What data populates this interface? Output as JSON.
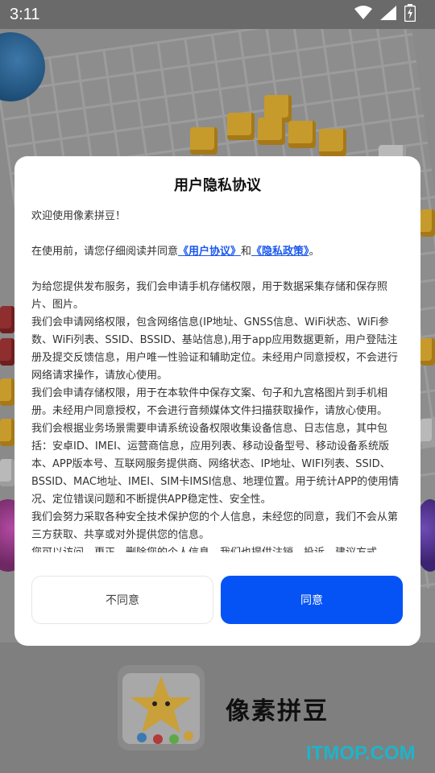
{
  "status_bar": {
    "time": "3:11",
    "icons": [
      "wifi-icon",
      "signal-icon",
      "battery-icon"
    ]
  },
  "dialog": {
    "title": "用户隐私协议",
    "welcome": "欢迎使用像素拼豆！",
    "intro_prefix": "在使用前，请您仔细阅读并同意",
    "user_agreement_link": "《用户协议》",
    "intro_and": "和",
    "privacy_policy_link": "《隐私政策》",
    "intro_suffix": "。",
    "paragraphs": [
      "为给您提供发布服务，我们会申请手机存储权限，用于数据采集存储和保存照片、图片。",
      "我们会申请网络权限，包含网络信息(IP地址、GNSS信息、WiFi状态、WiFi参数、WiFi列表、SSID、BSSID、基站信息),用于app应用数据更新，用户登陆注册及提交反馈信息，用户唯一性验证和辅助定位。未经用户同意授权，不会进行网络请求操作，请放心使用。",
      "我们会申请存储权限，用于在本软件中保存文案、句子和九宫格图片到手机相册。未经用户同意授权，不会进行音频媒体文件扫描获取操作，请放心使用。",
      "我们会根据业务场景需要申请系统设备权限收集设备信息、日志信息，其中包括：安卓ID、IMEI、运营商信息，应用列表、移动设备型号、移动设备系统版本、APP版本号、互联网服务提供商、网络状态、IP地址、WIFI列表、SSID、BSSID、MAC地址、IMEI、SIM卡IMSI信息、地理位置。用于统计APP的使用情况、定位错误问题和不断提供APP稳定性、安全性。",
      "我们会努力采取各种安全技术保护您的个人信息，未经您的同意，我们不会从第三方获取、共享或对外提供您的信息。",
      "您可以访问、更正、删除您的个人信息，我们也提供注销、投诉、建议方式"
    ],
    "disagree_label": "不同意",
    "agree_label": "同意"
  },
  "splash": {
    "app_name": "像素拼豆",
    "watermark": "ITMOP.COM"
  },
  "colors": {
    "accent": "#0553f5",
    "link": "#1a57ee",
    "watermark": "#1fb4c8"
  }
}
